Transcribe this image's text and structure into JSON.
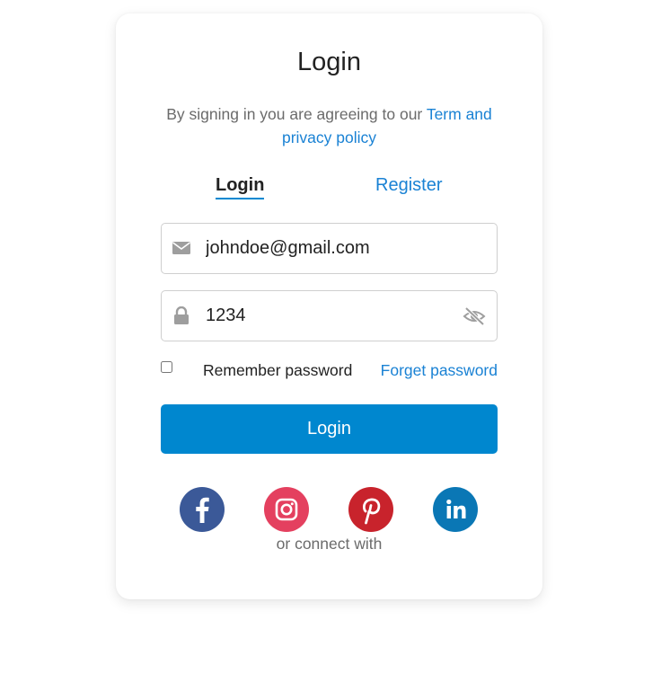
{
  "card": {
    "title": "Login",
    "subtitle_text": "By signing in you are agreeing to our ",
    "subtitle_link": "Term and privacy policy"
  },
  "tabs": [
    {
      "label": "Login",
      "active": true
    },
    {
      "label": "Register",
      "active": false
    }
  ],
  "form": {
    "email_value": "johndoe@gmail.com",
    "password_value": "1234",
    "remember_label": "Remember password",
    "remember_checked": false,
    "forget_label": "Forget password",
    "submit_label": "Login"
  },
  "social": {
    "connect_text": "or connect with",
    "providers": [
      {
        "name": "facebook-icon",
        "color": "#3b5998"
      },
      {
        "name": "instagram-icon",
        "color": "#e4405f"
      },
      {
        "name": "pinterest-icon",
        "color": "#c8232c"
      },
      {
        "name": "linkedin-icon",
        "color": "#0a77b5"
      }
    ]
  },
  "colors": {
    "accent": "#0087cf",
    "link": "#1a82d4",
    "text": "#222222",
    "muted": "#6b6b6b"
  }
}
